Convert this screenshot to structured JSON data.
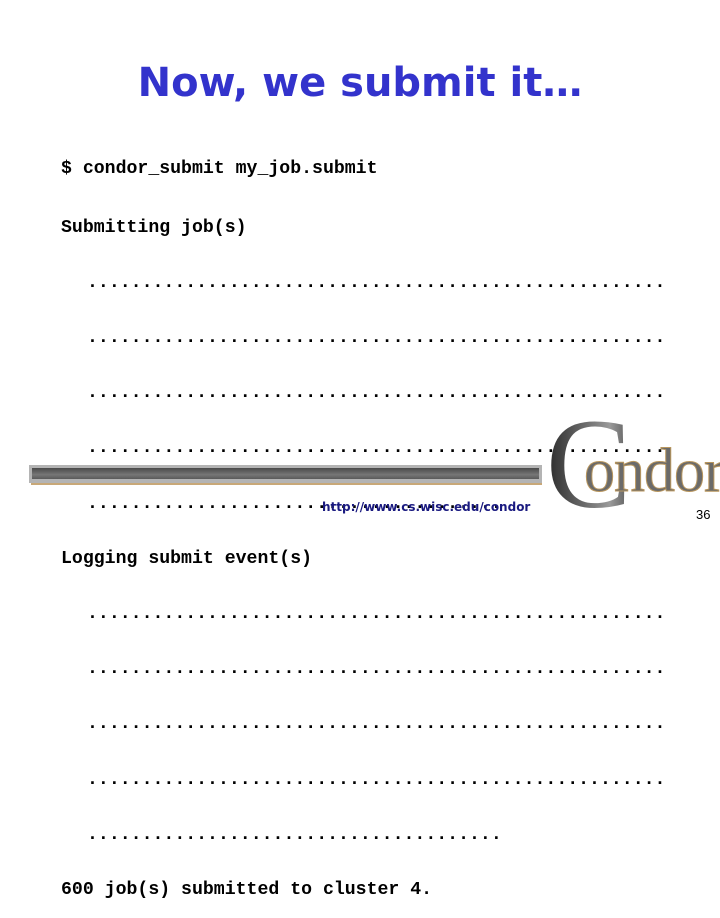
{
  "slide": {
    "title": "Now, we submit it…",
    "terminal": {
      "lines": [
        {
          "text": "$ condor_submit my_job.submit",
          "kind": "command"
        },
        {
          "text": "Submitting job(s)",
          "kind": "output"
        },
        {
          "text": ".....................................................",
          "kind": "dots"
        },
        {
          "text": ".....................................................",
          "kind": "dots"
        },
        {
          "text": ".....................................................",
          "kind": "dots"
        },
        {
          "text": ".....................................................",
          "kind": "dots"
        },
        {
          "text": "......................................",
          "kind": "dots"
        },
        {
          "text": "Logging submit event(s)",
          "kind": "output"
        },
        {
          "text": ".....................................................",
          "kind": "dots"
        },
        {
          "text": ".....................................................",
          "kind": "dots"
        },
        {
          "text": ".....................................................",
          "kind": "dots"
        },
        {
          "text": ".....................................................",
          "kind": "dots"
        },
        {
          "text": "......................................",
          "kind": "dots"
        },
        {
          "text": "600 job(s) submitted to cluster 4.",
          "kind": "output"
        }
      ]
    },
    "footer": {
      "url": "http://www.cs.wisc.edu/condor",
      "logo_initial": "C",
      "logo_rest": "ondor",
      "page_number": "36"
    },
    "colors": {
      "title": "#3333CC",
      "url": "#1a1a80",
      "logo_outline": "#b8965e"
    }
  }
}
